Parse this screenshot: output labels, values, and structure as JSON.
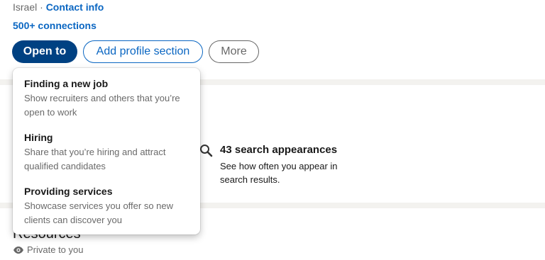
{
  "profile": {
    "location": "Israel",
    "separator": "·",
    "contact_link": "Contact info",
    "connections": "500+ connections"
  },
  "actions": {
    "open_to": "Open to",
    "add_section": "Add profile section",
    "more": "More"
  },
  "open_to_menu": {
    "items": [
      {
        "title": "Finding a new job",
        "description": "Show recruiters and others that you’re open to work"
      },
      {
        "title": "Hiring",
        "description": "Share that you’re hiring and attract qualified candidates"
      },
      {
        "title": "Providing services",
        "description": "Showcase services you offer so new clients can discover you"
      }
    ]
  },
  "analytics": {
    "search_appearances": "43 search appearances",
    "search_description": "See how often you appear in search results."
  },
  "resources": {
    "title": "Resources",
    "visibility": "Private to you"
  },
  "colors": {
    "accent": "#0a66c2",
    "primary_button": "#004182",
    "page_background": "#f3f2ef"
  },
  "icons": {
    "search": "search-icon",
    "visibility": "eye-icon"
  }
}
